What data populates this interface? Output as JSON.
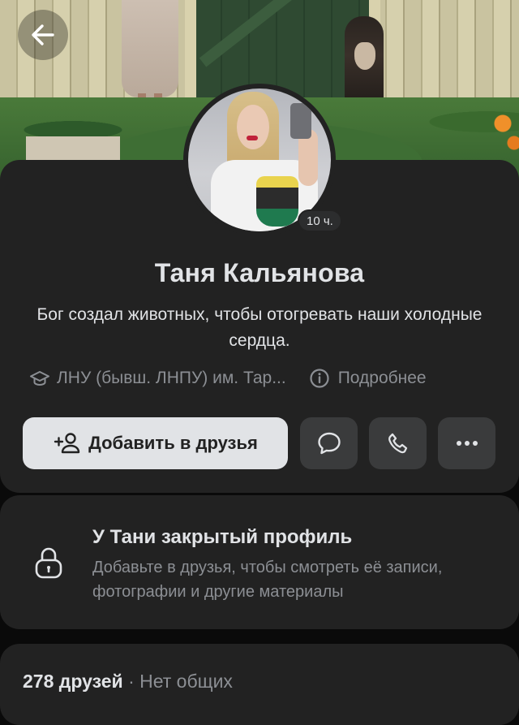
{
  "profile": {
    "name": "Таня Кальянова",
    "status": "Бог создал животных, чтобы отогревать наши холодные сердца.",
    "story_badge": "10 ч.",
    "education": "ЛНУ (бывш. ЛНПУ) им. Тар...",
    "details_label": "Подробнее"
  },
  "actions": {
    "add_friend_label": "Добавить в друзья",
    "message_icon": "message-bubble-icon",
    "call_icon": "phone-icon",
    "more_icon": "more-dots-icon"
  },
  "closed_profile": {
    "title": "У Тани закрытый профиль",
    "description": "Добавьте в друзья, чтобы смотреть её записи, фотографии и другие материалы"
  },
  "friends": {
    "count": "278 друзей",
    "separator": "·",
    "common": "Нет общих"
  },
  "colors": {
    "background": "#0a0a0a",
    "card": "#222222",
    "primary_text": "#e1e3e6",
    "secondary_text": "#8c8f94",
    "button_secondary": "#3a3b3c",
    "button_primary": "#e1e3e6"
  }
}
